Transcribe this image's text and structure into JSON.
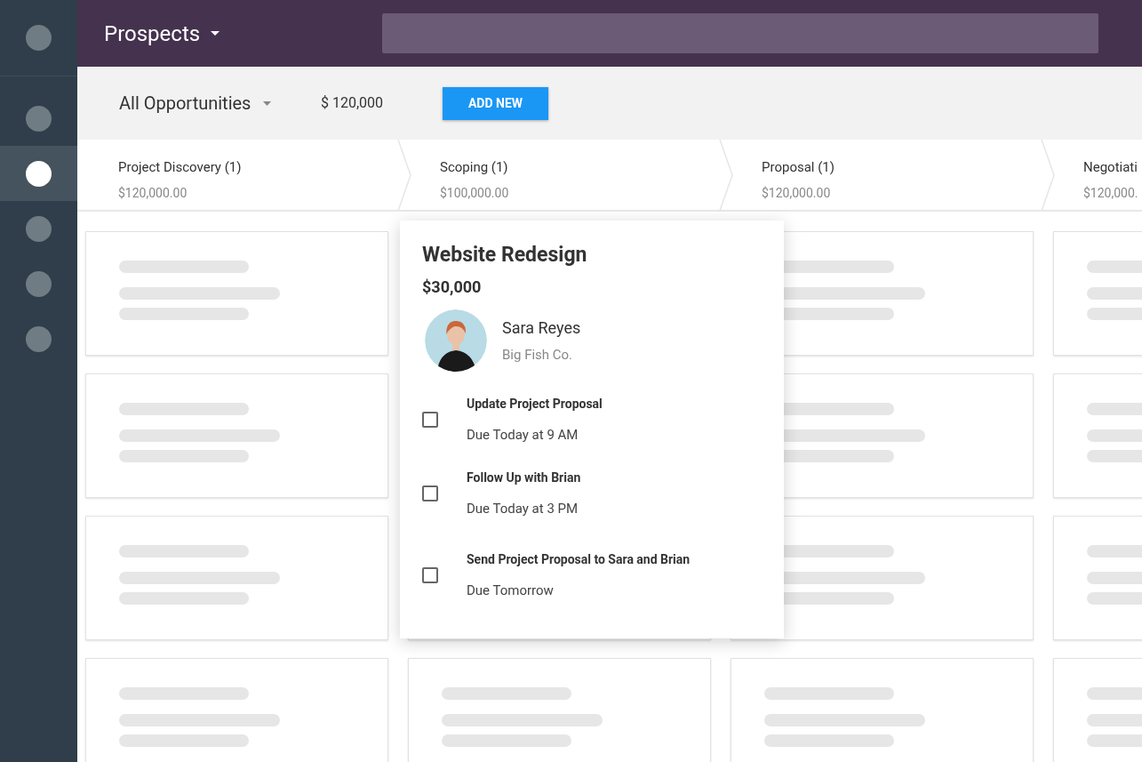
{
  "sidebar": {
    "items": [
      {
        "selected": false
      },
      {
        "selected": true
      },
      {
        "selected": false
      },
      {
        "selected": false
      },
      {
        "selected": false
      }
    ]
  },
  "header": {
    "title": "Prospects"
  },
  "toolbar": {
    "filter": "All Opportunities",
    "total": "$ 120,000",
    "add_button": "ADD NEW"
  },
  "stages": [
    {
      "name": "Project Discovery (1)",
      "amount": "$120,000.00"
    },
    {
      "name": "Scoping (1)",
      "amount": "$100,000.00"
    },
    {
      "name": "Proposal (1)",
      "amount": "$120,000.00"
    },
    {
      "name": "Negotiati",
      "amount": "$120,000."
    }
  ],
  "popup": {
    "title": "Website Redesign",
    "amount": "$30,000",
    "contact": {
      "name": "Sara Reyes",
      "company": "Big Fish Co."
    },
    "tasks": [
      {
        "title": "Update Project Proposal",
        "due": "Due Today at 9 AM",
        "checked": false
      },
      {
        "title": "Follow Up with Brian",
        "due": "Due Today at 3 PM",
        "checked": false
      },
      {
        "title": "Send Project Proposal to Sara and Brian",
        "due": "Due Tomorrow",
        "checked": false
      }
    ]
  }
}
